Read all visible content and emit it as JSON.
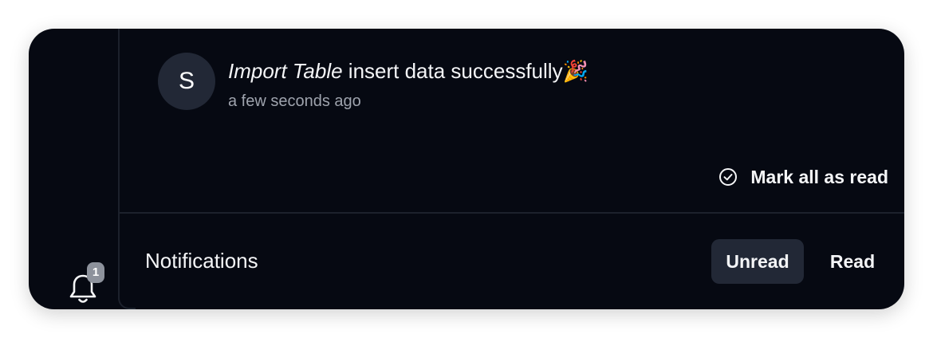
{
  "colors": {
    "background": "#060912",
    "surface": "#222836",
    "divider": "#1c212c",
    "text_primary": "#f4f5f7",
    "text_secondary": "#9ea3ad",
    "badge": "#8d929c"
  },
  "sidebar": {
    "bell_icon": "bell-icon",
    "badge_count": "1"
  },
  "notification": {
    "avatar_initial": "S",
    "title_italic": "Import Table",
    "title_rest": " insert data successfully",
    "emoji": "🎉",
    "time": "a few seconds ago"
  },
  "actions": {
    "mark_all_icon": "check-circle-icon",
    "mark_all_label": "Mark all as read"
  },
  "footer": {
    "title": "Notifications",
    "tabs": [
      {
        "label": "Unread",
        "selected": true
      },
      {
        "label": "Read",
        "selected": false
      }
    ]
  }
}
